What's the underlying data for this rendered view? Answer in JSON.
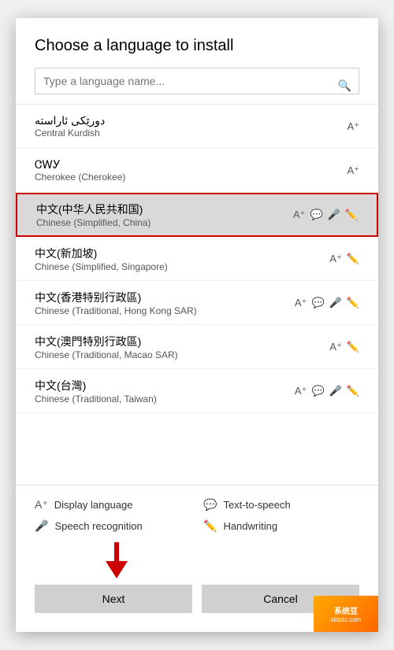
{
  "dialog": {
    "title": "Choose a language to install",
    "search_placeholder": "Type a language name...",
    "languages": [
      {
        "id": "central-kurdish",
        "name": "دورێکی ئاراستە",
        "sub": "Central Kurdish",
        "icons": [
          "display"
        ],
        "selected": false
      },
      {
        "id": "cherokee",
        "name": "ᏣᎳᎩ",
        "sub": "Cherokee (Cherokee)",
        "icons": [
          "display"
        ],
        "selected": false
      },
      {
        "id": "chinese-simplified-china",
        "name": "中文(中华人民共和国)",
        "sub": "Chinese (Simplified, China)",
        "icons": [
          "display",
          "tts",
          "speech",
          "handwriting"
        ],
        "selected": true
      },
      {
        "id": "chinese-simplified-singapore",
        "name": "中文(新加坡)",
        "sub": "Chinese (Simplified, Singapore)",
        "icons": [
          "display",
          "handwriting"
        ],
        "selected": false
      },
      {
        "id": "chinese-traditional-hk",
        "name": "中文(香港特别行政區)",
        "sub": "Chinese (Traditional, Hong Kong SAR)",
        "icons": [
          "display",
          "tts",
          "speech",
          "handwriting"
        ],
        "selected": false
      },
      {
        "id": "chinese-traditional-macao",
        "name": "中文(澳門特別行政區)",
        "sub": "Chinese (Traditional, Macao SAR)",
        "icons": [
          "display",
          "handwriting"
        ],
        "selected": false
      },
      {
        "id": "chinese-traditional-taiwan",
        "name": "中文(台灣)",
        "sub": "Chinese (Traditional, Taiwan)",
        "icons": [
          "display",
          "tts",
          "speech",
          "handwriting"
        ],
        "selected": false
      }
    ],
    "legend": [
      {
        "icon": "display",
        "label": "Display language"
      },
      {
        "icon": "tts",
        "label": "Text-to-speech"
      },
      {
        "icon": "speech",
        "label": "Speech recognition"
      },
      {
        "icon": "handwriting",
        "label": "Handwriting"
      }
    ],
    "buttons": {
      "next": "Next",
      "cancel": "Cancel"
    }
  }
}
